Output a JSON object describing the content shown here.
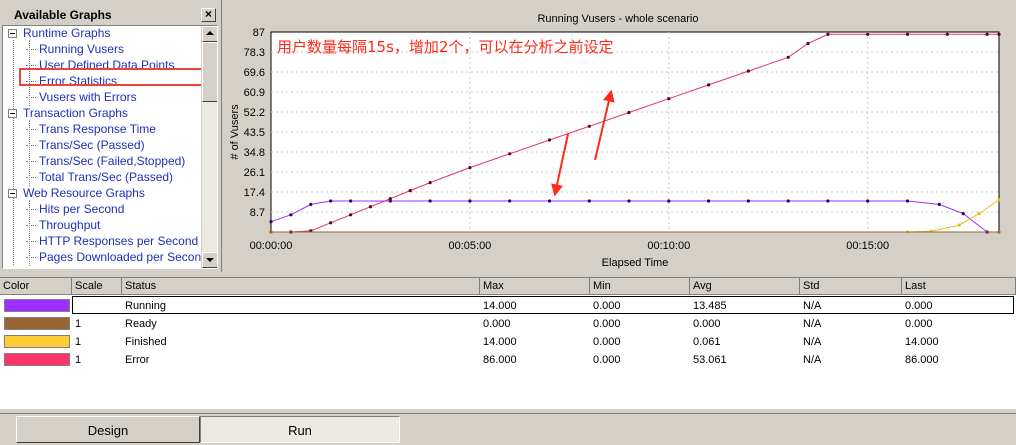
{
  "tree": {
    "title": "Available Graphs",
    "close_label": "×",
    "groups": [
      {
        "label": "Runtime Graphs",
        "items": [
          "Running Vusers",
          "User Defined Data Points",
          "Error Statistics",
          "Vusers with Errors"
        ]
      },
      {
        "label": "Transaction Graphs",
        "items": [
          "Trans Response Time",
          "Trans/Sec (Passed)",
          "Trans/Sec (Failed,Stopped)",
          "Total Trans/Sec (Passed)"
        ]
      },
      {
        "label": "Web Resource Graphs",
        "items": [
          "Hits per Second",
          "Throughput",
          "HTTP Responses per Second",
          "Pages Downloaded per Second"
        ]
      }
    ],
    "selected": "Running Vusers"
  },
  "chart_data": {
    "type": "line",
    "title": "Running Vusers - whole scenario",
    "xlabel": "Elapsed Time",
    "ylabel": "# of Vusers",
    "x_ticks": [
      "00:00:00",
      "00:05:00",
      "00:10:00",
      "00:15:00"
    ],
    "y_ticks": [
      8.7,
      17.4,
      26.1,
      34.8,
      43.5,
      52.2,
      60.9,
      69.6,
      78.3,
      87
    ],
    "ylim": [
      0,
      87
    ],
    "x_unit": "minutes",
    "xlim": [
      0,
      18.3
    ],
    "annotation": "用户数量每隔15s，增加2个，可以在分析之前设定",
    "grid": true,
    "series": [
      {
        "name": "Running",
        "color": "#9b30ff",
        "marker_color": "#3a005a",
        "points": [
          [
            0,
            4.5
          ],
          [
            0.5,
            7.5
          ],
          [
            1,
            12
          ],
          [
            1.5,
            13.5
          ],
          [
            2,
            13.5
          ],
          [
            3,
            13.5
          ],
          [
            4,
            13.5
          ],
          [
            5,
            13.5
          ],
          [
            6,
            13.5
          ],
          [
            7,
            13.5
          ],
          [
            8,
            13.5
          ],
          [
            9,
            13.5
          ],
          [
            10,
            13.5
          ],
          [
            11,
            13.5
          ],
          [
            12,
            13.5
          ],
          [
            13,
            13.5
          ],
          [
            14,
            13.5
          ],
          [
            15,
            13.5
          ],
          [
            16,
            13.5
          ],
          [
            16.8,
            12
          ],
          [
            17.4,
            8
          ],
          [
            18,
            0
          ]
        ]
      },
      {
        "name": "Error",
        "color": "#e8336a",
        "marker_color": "#5a0020",
        "points": [
          [
            0,
            0
          ],
          [
            0.5,
            0
          ],
          [
            1,
            0.5
          ],
          [
            1.5,
            4
          ],
          [
            2,
            7.5
          ],
          [
            2.5,
            11
          ],
          [
            3,
            14.5
          ],
          [
            3.5,
            18
          ],
          [
            4,
            21.5
          ],
          [
            5,
            28
          ],
          [
            6,
            34
          ],
          [
            7,
            40
          ],
          [
            8,
            46
          ],
          [
            9,
            52
          ],
          [
            10,
            58
          ],
          [
            11,
            64
          ],
          [
            12,
            70
          ],
          [
            13,
            76
          ],
          [
            13.5,
            82
          ],
          [
            14,
            86
          ],
          [
            15,
            86
          ],
          [
            16,
            86
          ],
          [
            17,
            86
          ],
          [
            18,
            86
          ],
          [
            18.3,
            86
          ]
        ]
      },
      {
        "name": "Finished",
        "color": "#f2b81f",
        "marker_color": "#f2b81f",
        "points": [
          [
            0,
            0
          ],
          [
            16,
            0
          ],
          [
            16.6,
            0.3
          ],
          [
            17.3,
            3
          ],
          [
            17.8,
            8
          ],
          [
            18.3,
            14
          ]
        ]
      },
      {
        "name": "Ready",
        "color": "#996633",
        "marker_color": "#996633",
        "points": [
          [
            0,
            0
          ],
          [
            18.3,
            0
          ]
        ]
      }
    ]
  },
  "legend_table": {
    "headers": [
      "Color",
      "Scale",
      "Status",
      "Max",
      "Min",
      "Avg",
      "Std",
      "Last"
    ],
    "rows": [
      {
        "color": "#9b30ff",
        "scale": "",
        "status": "Running",
        "max": "14.000",
        "min": "0.000",
        "avg": "13.485",
        "std": "N/A",
        "last": "0.000"
      },
      {
        "color": "#996633",
        "scale": "1",
        "status": "Ready",
        "max": "0.000",
        "min": "0.000",
        "avg": "0.000",
        "std": "N/A",
        "last": "0.000"
      },
      {
        "color": "#ffcc33",
        "scale": "1",
        "status": "Finished",
        "max": "14.000",
        "min": "0.000",
        "avg": "0.061",
        "std": "N/A",
        "last": "14.000"
      },
      {
        "color": "#ff3366",
        "scale": "1",
        "status": "Error",
        "max": "86.000",
        "min": "0.000",
        "avg": "53.061",
        "std": "N/A",
        "last": "86.000"
      }
    ]
  },
  "tabs": [
    {
      "label": "Design"
    },
    {
      "label": "Run"
    }
  ],
  "active_tab": "Run",
  "colors": {
    "accent_red": "#e8453c",
    "tree_text": "#1f2fb8",
    "chart_bg": "#ffffff"
  }
}
